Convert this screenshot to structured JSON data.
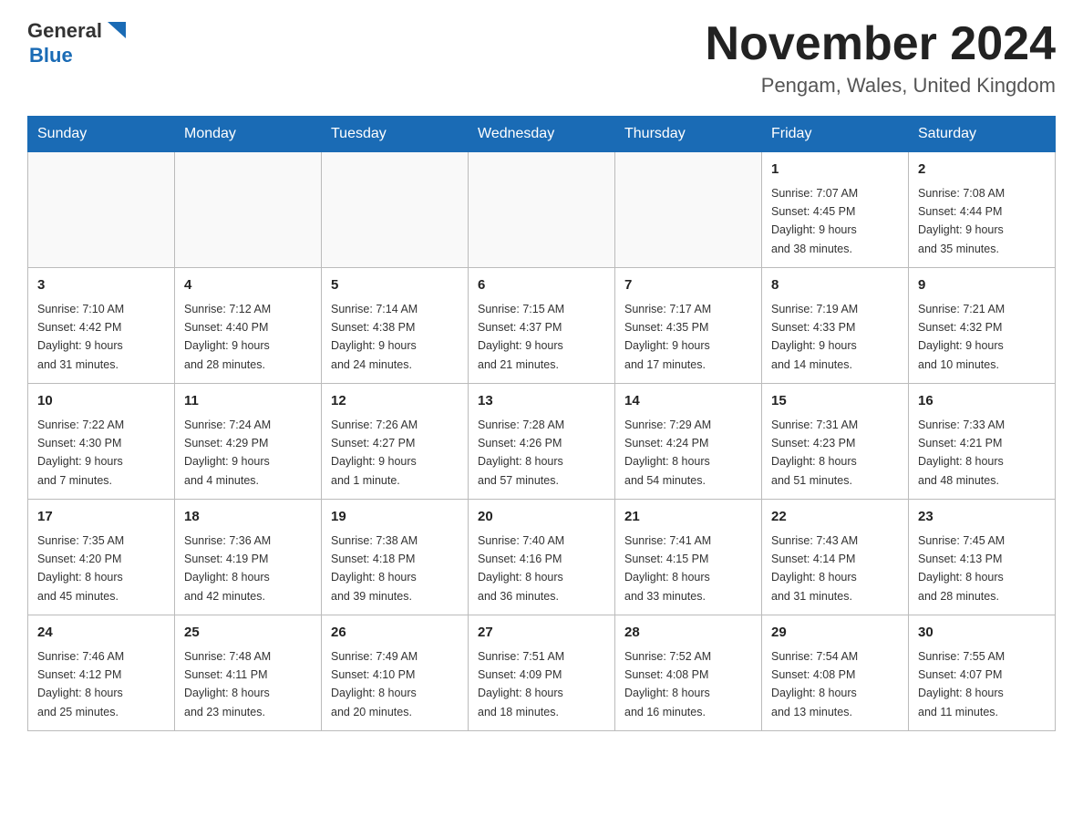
{
  "header": {
    "logo": {
      "text_general": "General",
      "text_blue": "Blue",
      "triangle_color": "#1a6bb5"
    },
    "month_title": "November 2024",
    "location": "Pengam, Wales, United Kingdom"
  },
  "calendar": {
    "days_of_week": [
      "Sunday",
      "Monday",
      "Tuesday",
      "Wednesday",
      "Thursday",
      "Friday",
      "Saturday"
    ],
    "weeks": [
      [
        {
          "day": "",
          "info": ""
        },
        {
          "day": "",
          "info": ""
        },
        {
          "day": "",
          "info": ""
        },
        {
          "day": "",
          "info": ""
        },
        {
          "day": "",
          "info": ""
        },
        {
          "day": "1",
          "info": "Sunrise: 7:07 AM\nSunset: 4:45 PM\nDaylight: 9 hours\nand 38 minutes."
        },
        {
          "day": "2",
          "info": "Sunrise: 7:08 AM\nSunset: 4:44 PM\nDaylight: 9 hours\nand 35 minutes."
        }
      ],
      [
        {
          "day": "3",
          "info": "Sunrise: 7:10 AM\nSunset: 4:42 PM\nDaylight: 9 hours\nand 31 minutes."
        },
        {
          "day": "4",
          "info": "Sunrise: 7:12 AM\nSunset: 4:40 PM\nDaylight: 9 hours\nand 28 minutes."
        },
        {
          "day": "5",
          "info": "Sunrise: 7:14 AM\nSunset: 4:38 PM\nDaylight: 9 hours\nand 24 minutes."
        },
        {
          "day": "6",
          "info": "Sunrise: 7:15 AM\nSunset: 4:37 PM\nDaylight: 9 hours\nand 21 minutes."
        },
        {
          "day": "7",
          "info": "Sunrise: 7:17 AM\nSunset: 4:35 PM\nDaylight: 9 hours\nand 17 minutes."
        },
        {
          "day": "8",
          "info": "Sunrise: 7:19 AM\nSunset: 4:33 PM\nDaylight: 9 hours\nand 14 minutes."
        },
        {
          "day": "9",
          "info": "Sunrise: 7:21 AM\nSunset: 4:32 PM\nDaylight: 9 hours\nand 10 minutes."
        }
      ],
      [
        {
          "day": "10",
          "info": "Sunrise: 7:22 AM\nSunset: 4:30 PM\nDaylight: 9 hours\nand 7 minutes."
        },
        {
          "day": "11",
          "info": "Sunrise: 7:24 AM\nSunset: 4:29 PM\nDaylight: 9 hours\nand 4 minutes."
        },
        {
          "day": "12",
          "info": "Sunrise: 7:26 AM\nSunset: 4:27 PM\nDaylight: 9 hours\nand 1 minute."
        },
        {
          "day": "13",
          "info": "Sunrise: 7:28 AM\nSunset: 4:26 PM\nDaylight: 8 hours\nand 57 minutes."
        },
        {
          "day": "14",
          "info": "Sunrise: 7:29 AM\nSunset: 4:24 PM\nDaylight: 8 hours\nand 54 minutes."
        },
        {
          "day": "15",
          "info": "Sunrise: 7:31 AM\nSunset: 4:23 PM\nDaylight: 8 hours\nand 51 minutes."
        },
        {
          "day": "16",
          "info": "Sunrise: 7:33 AM\nSunset: 4:21 PM\nDaylight: 8 hours\nand 48 minutes."
        }
      ],
      [
        {
          "day": "17",
          "info": "Sunrise: 7:35 AM\nSunset: 4:20 PM\nDaylight: 8 hours\nand 45 minutes."
        },
        {
          "day": "18",
          "info": "Sunrise: 7:36 AM\nSunset: 4:19 PM\nDaylight: 8 hours\nand 42 minutes."
        },
        {
          "day": "19",
          "info": "Sunrise: 7:38 AM\nSunset: 4:18 PM\nDaylight: 8 hours\nand 39 minutes."
        },
        {
          "day": "20",
          "info": "Sunrise: 7:40 AM\nSunset: 4:16 PM\nDaylight: 8 hours\nand 36 minutes."
        },
        {
          "day": "21",
          "info": "Sunrise: 7:41 AM\nSunset: 4:15 PM\nDaylight: 8 hours\nand 33 minutes."
        },
        {
          "day": "22",
          "info": "Sunrise: 7:43 AM\nSunset: 4:14 PM\nDaylight: 8 hours\nand 31 minutes."
        },
        {
          "day": "23",
          "info": "Sunrise: 7:45 AM\nSunset: 4:13 PM\nDaylight: 8 hours\nand 28 minutes."
        }
      ],
      [
        {
          "day": "24",
          "info": "Sunrise: 7:46 AM\nSunset: 4:12 PM\nDaylight: 8 hours\nand 25 minutes."
        },
        {
          "day": "25",
          "info": "Sunrise: 7:48 AM\nSunset: 4:11 PM\nDaylight: 8 hours\nand 23 minutes."
        },
        {
          "day": "26",
          "info": "Sunrise: 7:49 AM\nSunset: 4:10 PM\nDaylight: 8 hours\nand 20 minutes."
        },
        {
          "day": "27",
          "info": "Sunrise: 7:51 AM\nSunset: 4:09 PM\nDaylight: 8 hours\nand 18 minutes."
        },
        {
          "day": "28",
          "info": "Sunrise: 7:52 AM\nSunset: 4:08 PM\nDaylight: 8 hours\nand 16 minutes."
        },
        {
          "day": "29",
          "info": "Sunrise: 7:54 AM\nSunset: 4:08 PM\nDaylight: 8 hours\nand 13 minutes."
        },
        {
          "day": "30",
          "info": "Sunrise: 7:55 AM\nSunset: 4:07 PM\nDaylight: 8 hours\nand 11 minutes."
        }
      ]
    ]
  }
}
